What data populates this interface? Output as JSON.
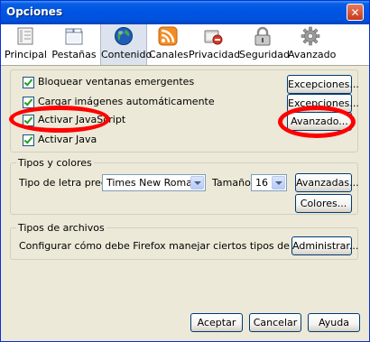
{
  "window": {
    "title": "Opciones",
    "close_glyph": "✕"
  },
  "toolbar": {
    "tabs": [
      {
        "label": "Principal",
        "icon": "principal-icon"
      },
      {
        "label": "Pestañas",
        "icon": "tabs-icon"
      },
      {
        "label": "Contenido",
        "icon": "globe-icon",
        "selected": true
      },
      {
        "label": "Canales",
        "icon": "rss-icon"
      },
      {
        "label": "Privacidad",
        "icon": "privacy-icon"
      },
      {
        "label": "Seguridad",
        "icon": "padlock-icon"
      },
      {
        "label": "Avanzado",
        "icon": "gear-icon"
      }
    ]
  },
  "content": {
    "options": [
      {
        "label": "Bloquear ventanas emergentes",
        "checked": true,
        "button": "Excepciones..."
      },
      {
        "label": "Cargar imágenes automáticamente",
        "checked": true,
        "button": "Excepciones..."
      },
      {
        "label": "Activar JavaScript",
        "checked": true,
        "button": "Avanzado..."
      },
      {
        "label": "Activar Java",
        "checked": true
      }
    ]
  },
  "fonts": {
    "legend": "Tipos y colores",
    "font_label": "Tipo de letra predet.:",
    "font_value": "Times New Roman",
    "size_label": "Tamaño:",
    "size_value": "16",
    "advanced_button": "Avanzadas...",
    "colors_button": "Colores..."
  },
  "files": {
    "legend": "Tipos de archivos",
    "description": "Configurar cómo debe Firefox manejar ciertos tipos de archivos",
    "manage_button": "Administrar..."
  },
  "footer": {
    "accept_button": "Aceptar",
    "cancel_button": "Cancelar",
    "help_button": "Ayuda"
  },
  "colors": {
    "highlight_red": "#ff0000",
    "title_blue": "#0055e5",
    "dialog_bg": "#ece9d8"
  }
}
